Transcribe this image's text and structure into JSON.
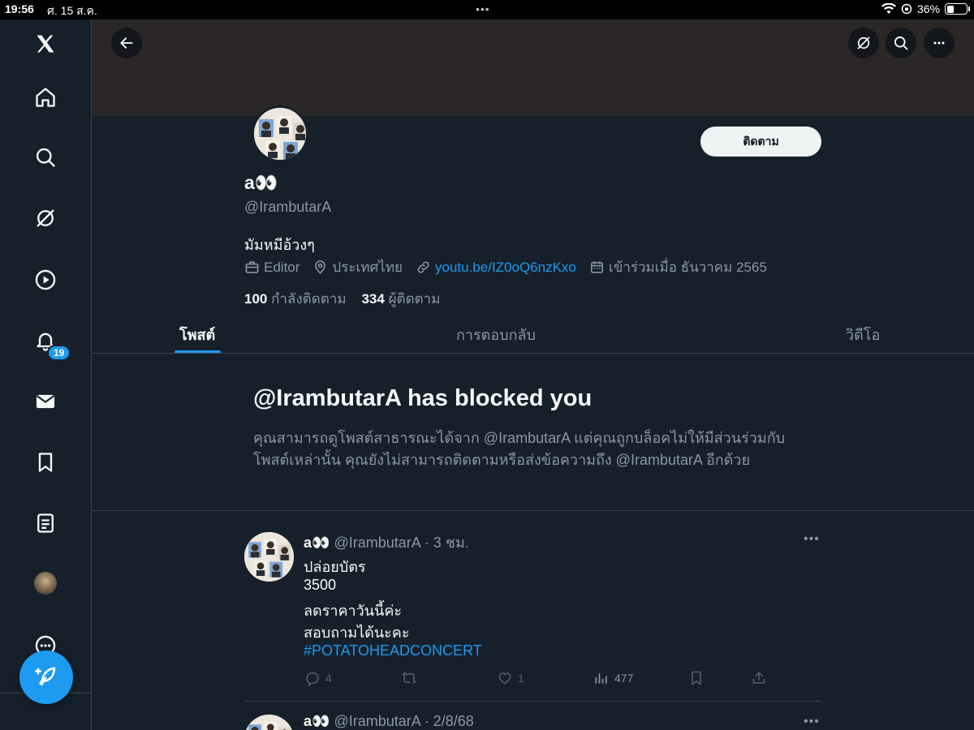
{
  "status_bar": {
    "time": "19:56",
    "date": "ศ. 15 ส.ค.",
    "battery": "36%",
    "battery_fraction": 0.36
  },
  "sidebar": {
    "items": [
      {
        "icon": "x-logo-icon"
      },
      {
        "icon": "home-icon"
      },
      {
        "icon": "search-icon"
      },
      {
        "icon": "grok-icon"
      },
      {
        "icon": "video-icon"
      },
      {
        "icon": "notifications-icon",
        "badge": "19"
      },
      {
        "icon": "messages-icon"
      },
      {
        "icon": "bookmarks-icon"
      },
      {
        "icon": "lists-icon"
      },
      {
        "icon": "profile-avatar"
      },
      {
        "icon": "more-icon"
      }
    ],
    "compose_icon": "compose-feather-icon"
  },
  "header": {
    "back_icon": "back-arrow-icon",
    "grok_icon": "grok-icon",
    "search_icon": "search-icon",
    "more_icon": "more-icon"
  },
  "profile": {
    "name": "a👀",
    "handle": "@IrambutarA",
    "bio": "มัมหมีอ้วงๆ",
    "category": "Editor",
    "location": "ประเทศไทย",
    "link": "youtu.be/IZ0oQ6nzKxo",
    "joined": "เข้าร่วมเมื่อ ธันวาคม 2565",
    "following_count": "100",
    "following_label": "กำลังติดตาม",
    "followers_count": "334",
    "followers_label": "ผู้ติดตาม",
    "follow_button": "ติดตาม"
  },
  "tabs": [
    {
      "label": "โพสต์",
      "active": true
    },
    {
      "label": "การตอบกลับ",
      "active": false
    },
    {
      "label": "วิดีโอ",
      "active": false
    }
  ],
  "blocked": {
    "title": "@IrambutarA has blocked you",
    "line1": "คุณสามารถดูโพสต์สาธารณะได้จาก @IrambutarA แต่คุณถูกบล็อคไม่ให้มีส่วนร่วมกับ",
    "line2": "โพสต์เหล่านั้น คุณยังไม่สามารถติดตามหรือส่งข้อความถึง @IrambutarA อีกด้วย"
  },
  "tweets": [
    {
      "name": "a👀",
      "handle": "@IrambutarA",
      "time": "· 3 ชม.",
      "lines": [
        "ปล่อยบัตร",
        "3500",
        "ลดราคาวันนี้ค่ะ",
        "สอบถามได้นะคะ"
      ],
      "hashtag": "#POTATOHEADCONCERT",
      "replies": "4",
      "retweets": "",
      "likes": "1",
      "views": "477"
    },
    {
      "name": "a👀",
      "handle": "@IrambutarA",
      "time": "· 2/8/68"
    }
  ],
  "colors": {
    "accent": "#1d9bf0",
    "background": "#15202b",
    "border": "#38444d",
    "muted": "#8b98a5"
  }
}
